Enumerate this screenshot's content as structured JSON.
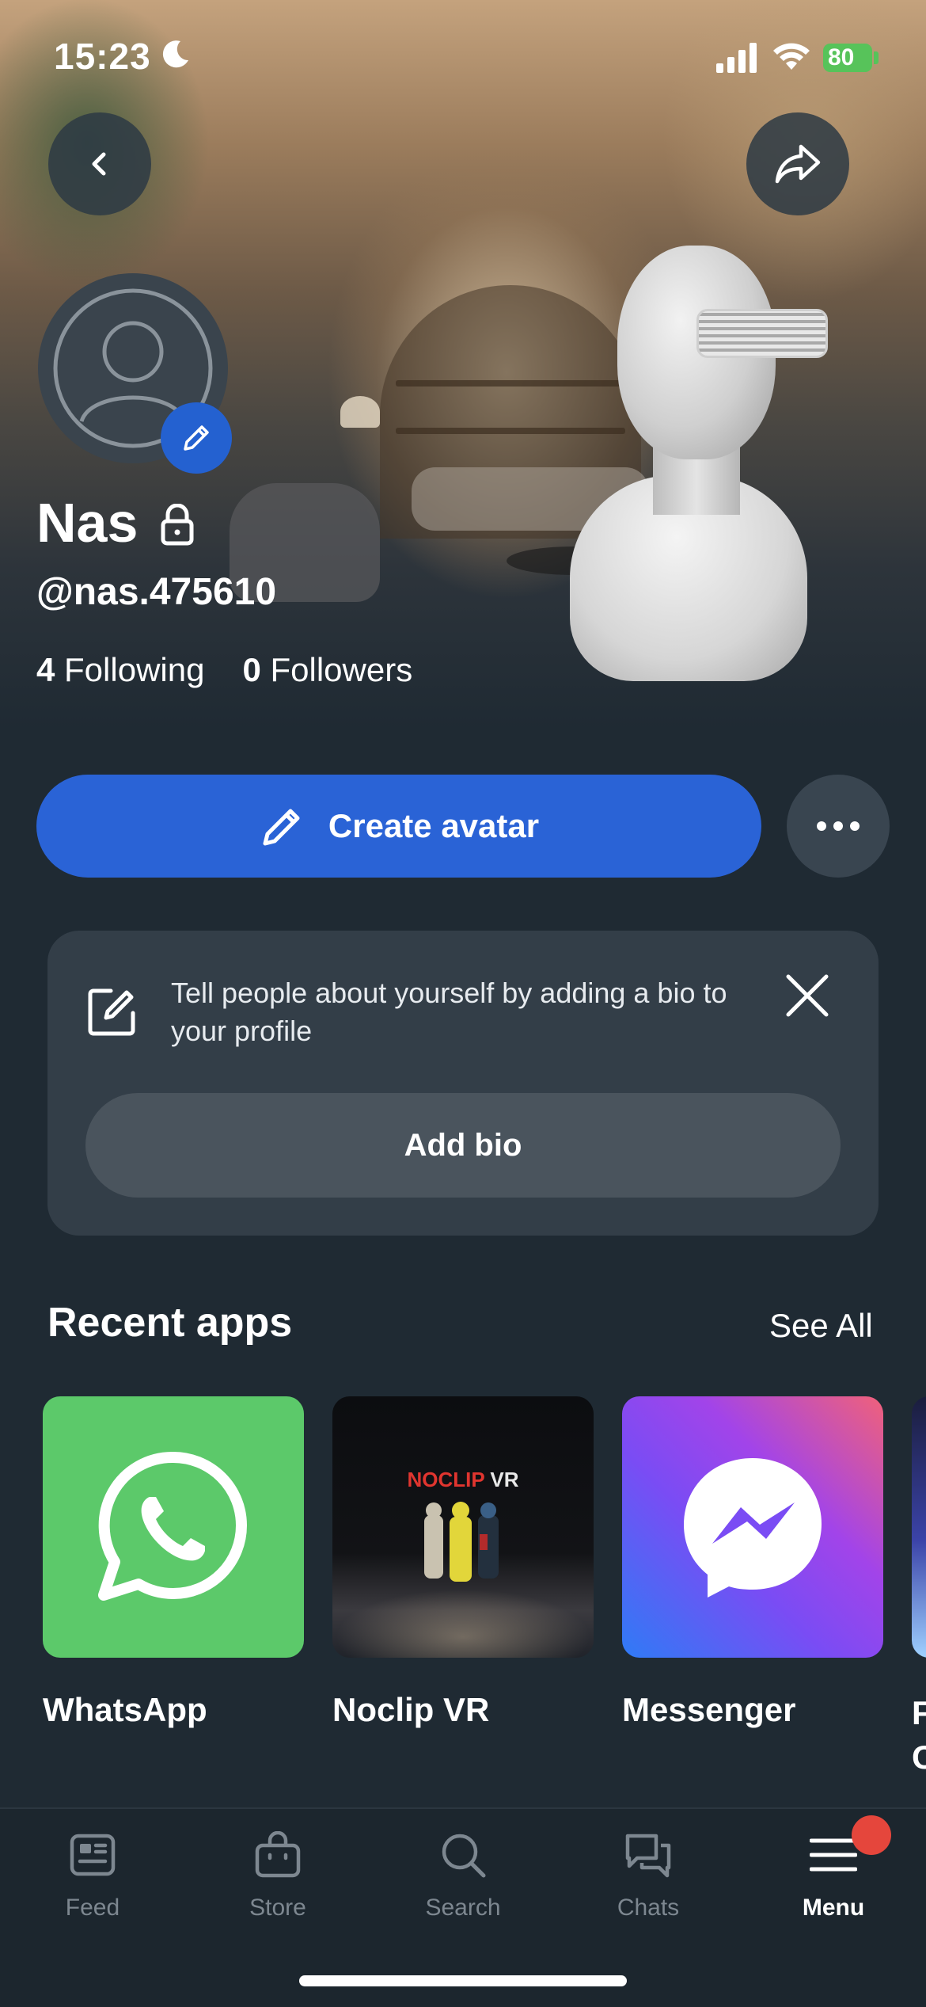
{
  "status_bar": {
    "time": "15:23",
    "battery": "80"
  },
  "profile": {
    "name": "Nas",
    "handle": "@nas.475610",
    "following_count": "4",
    "following_label": "Following",
    "followers_count": "0",
    "followers_label": "Followers"
  },
  "actions": {
    "create_avatar_label": "Create avatar"
  },
  "bio_prompt": {
    "text": "Tell people about yourself by adding a bio to your profile",
    "button_label": "Add bio"
  },
  "recent_apps": {
    "title": "Recent apps",
    "see_all_label": "See All",
    "apps": [
      {
        "name": "WhatsApp"
      },
      {
        "name": "Noclip VR",
        "tile_text_a": "NOCLIP",
        "tile_text_b": " VR"
      },
      {
        "name": "Messenger"
      }
    ],
    "partial_label": "F\nC"
  },
  "tab_bar": {
    "tabs": [
      {
        "label": "Feed",
        "icon": "feed-icon"
      },
      {
        "label": "Store",
        "icon": "store-icon"
      },
      {
        "label": "Search",
        "icon": "search-icon"
      },
      {
        "label": "Chats",
        "icon": "chats-icon"
      },
      {
        "label": "Menu",
        "icon": "menu-icon",
        "active": true
      }
    ]
  },
  "colors": {
    "background": "#1f2a33",
    "primary_button": "#2a63d6",
    "whatsapp": "#5cc96a",
    "notification": "#e5463c",
    "battery": "#57c35a"
  }
}
